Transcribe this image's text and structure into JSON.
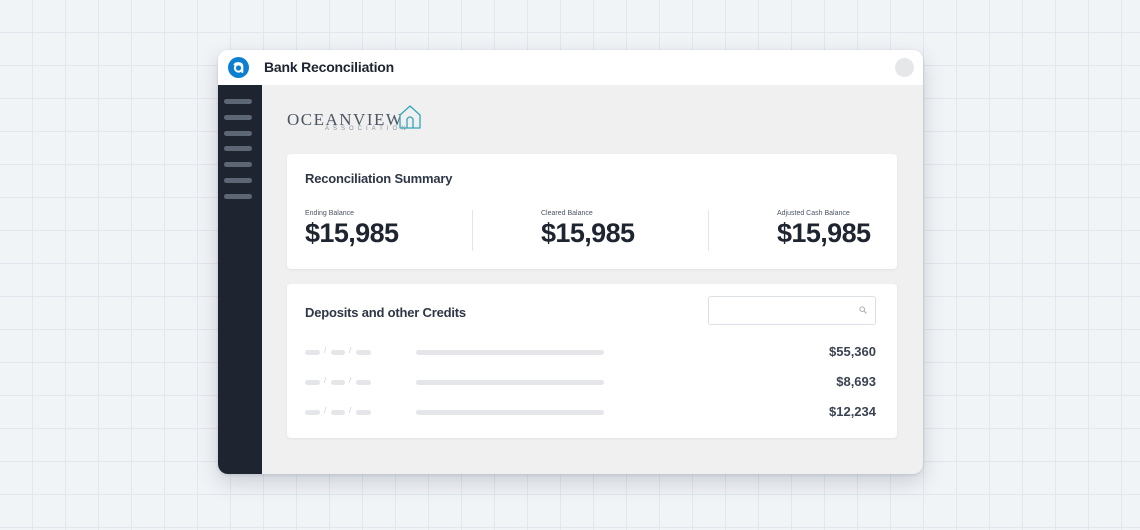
{
  "window": {
    "title": "Bank Reconciliation",
    "icons": {
      "app_logo": "a-logo-icon",
      "control": "window-control-icon"
    }
  },
  "sidebar": {
    "items": [
      {
        "name": "nav-item-1"
      },
      {
        "name": "nav-item-2"
      },
      {
        "name": "nav-item-3"
      },
      {
        "name": "nav-item-4"
      },
      {
        "name": "nav-item-5"
      },
      {
        "name": "nav-item-6"
      },
      {
        "name": "nav-item-7"
      }
    ]
  },
  "brand": {
    "name": "OCEANVIEW",
    "subtitle": "ASSOCIATION",
    "icon": "house-outline-icon"
  },
  "summary": {
    "title": "Reconciliation Summary",
    "stats": [
      {
        "label": "Ending Balance",
        "value": "$15,985"
      },
      {
        "label": "Cleared Balance",
        "value": "$15,985"
      },
      {
        "label": "Adjusted Cash Balance",
        "value": "$15,985"
      }
    ]
  },
  "deposits": {
    "title": "Deposits and other Credits",
    "search": {
      "placeholder": "",
      "value": "",
      "icon": "search-icon"
    },
    "rows": [
      {
        "amount": "$55,360"
      },
      {
        "amount": "$8,693"
      },
      {
        "amount": "$12,234"
      }
    ]
  },
  "colors": {
    "accent": "#0d7fd0",
    "sidebar": "#1f2530",
    "window_bg": "#f0f0f0",
    "page_grid": "#e2e7ed"
  }
}
